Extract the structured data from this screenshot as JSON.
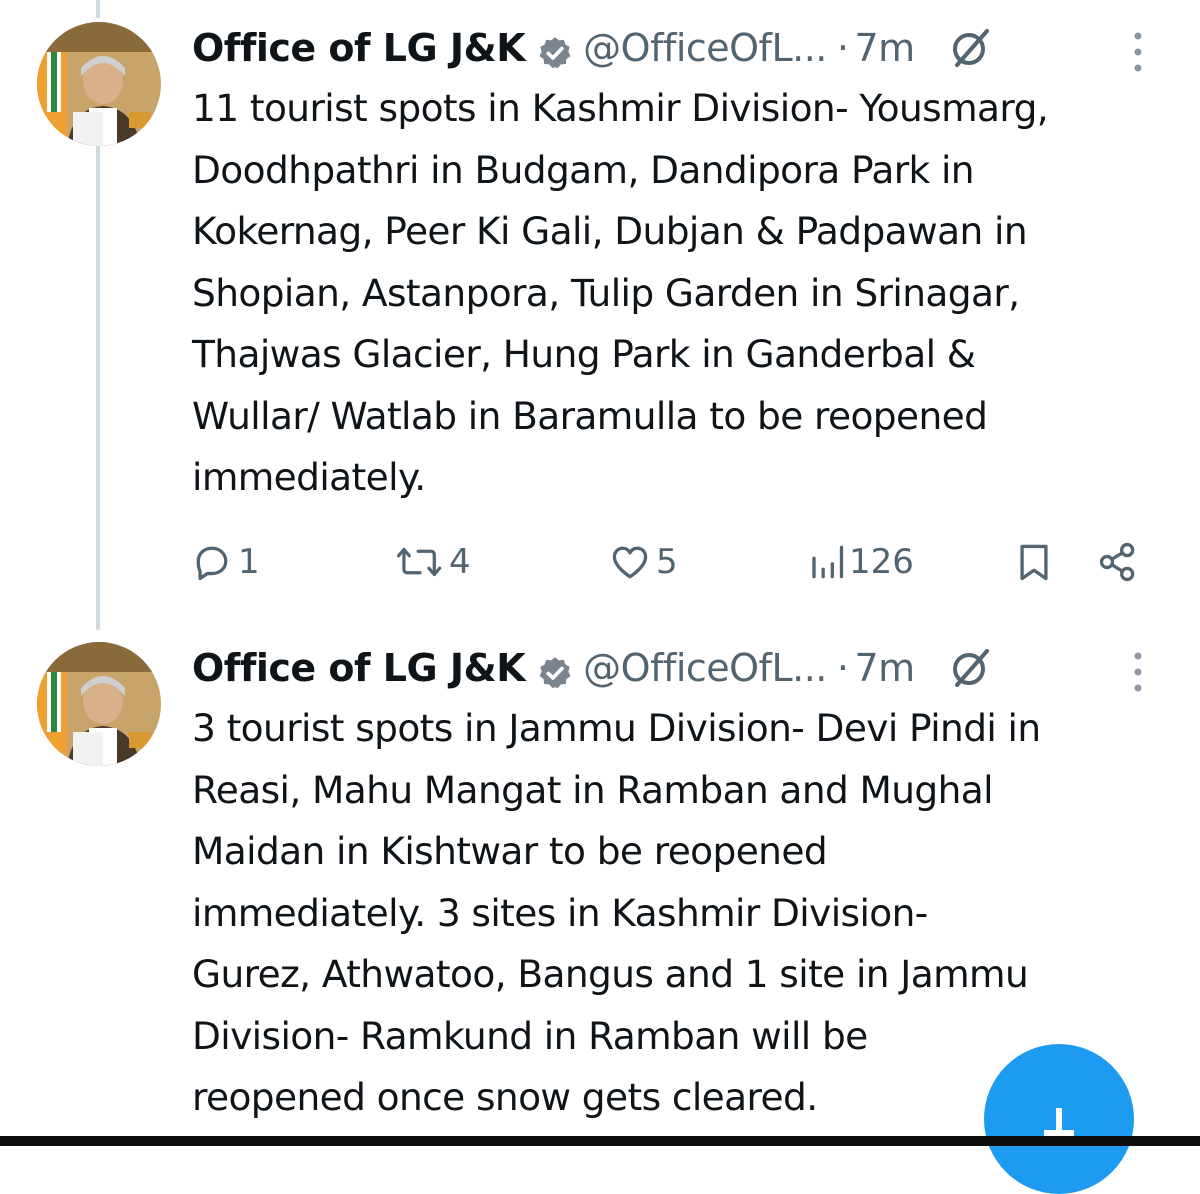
{
  "tweets": [
    {
      "author_name": "Office of LG J&K",
      "handle": "@OfficeOfL...",
      "separator": "·",
      "time": "7m",
      "text": "11 tourist spots in Kashmir Division- Yousmarg,\nDoodhpathri in Budgam, Dandipora Park in\nKokernag, Peer Ki Gali, Dubjan & Padpawan in\nShopian, Astanpora, Tulip Garden in Srinagar,\nThajwas Glacier, Hung Park in Ganderbal &\nWullar/ Watlab in Baramulla to be reopened\nimmediately.",
      "replies": "1",
      "retweets": "4",
      "likes": "5",
      "views": "126"
    },
    {
      "author_name": "Office of LG J&K",
      "handle": "@OfficeOfL...",
      "separator": "·",
      "time": "7m",
      "text": "3 tourist spots in Jammu Division- Devi Pindi in\nReasi, Mahu Mangat in Ramban and Mughal\nMaidan in Kishtwar to be reopened\nimmediately. 3 sites in Kashmir Division-\nGurez, Athwatoo, Bangus and 1 site in Jammu\nDivision- Ramkund in Ramban will be\nreopened once snow gets cleared."
    }
  ],
  "icons": {
    "verified": "verified-badge-icon",
    "grok": "grok-icon",
    "more": "more-options-icon",
    "reply": "reply-icon",
    "retweet": "retweet-icon",
    "like": "like-icon",
    "views": "views-icon",
    "bookmark": "bookmark-icon",
    "share": "share-icon",
    "compose": "compose-plus-icon"
  },
  "colors": {
    "text": "#0f1419",
    "secondary": "#536471",
    "accent": "#1d9bf0",
    "thread_line": "#cfd9de"
  }
}
